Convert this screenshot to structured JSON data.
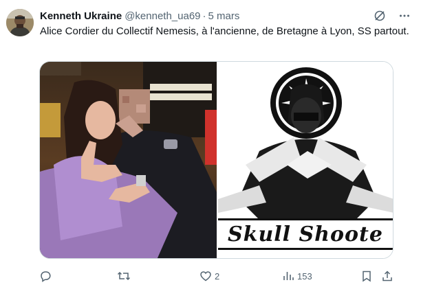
{
  "author": {
    "name": "Kenneth Ukraine",
    "handle": "@kenneth_ua69",
    "separator": "·",
    "timestamp": "5 mars"
  },
  "tweet": {
    "text": "Alice Cordier du Collectif Nemesis, à l'ancienne, de Bretagne à Lyon, SS partout."
  },
  "media": {
    "left_image": "photo-woman-hand-sign",
    "right_image": "graphic-skull-shooters",
    "banner_text": "Skull Shoote"
  },
  "actions": {
    "reply_count": "",
    "retweet_count": "",
    "like_count": "2",
    "views_count": "153"
  },
  "icons": {
    "grok": "grok-icon",
    "more": "more-icon",
    "reply": "reply-icon",
    "retweet": "retweet-icon",
    "like": "like-icon",
    "views": "views-icon",
    "bookmark": "bookmark-icon",
    "share": "share-icon"
  },
  "colors": {
    "text": "#0f1419",
    "muted": "#536471",
    "border": "#cfd9de"
  }
}
